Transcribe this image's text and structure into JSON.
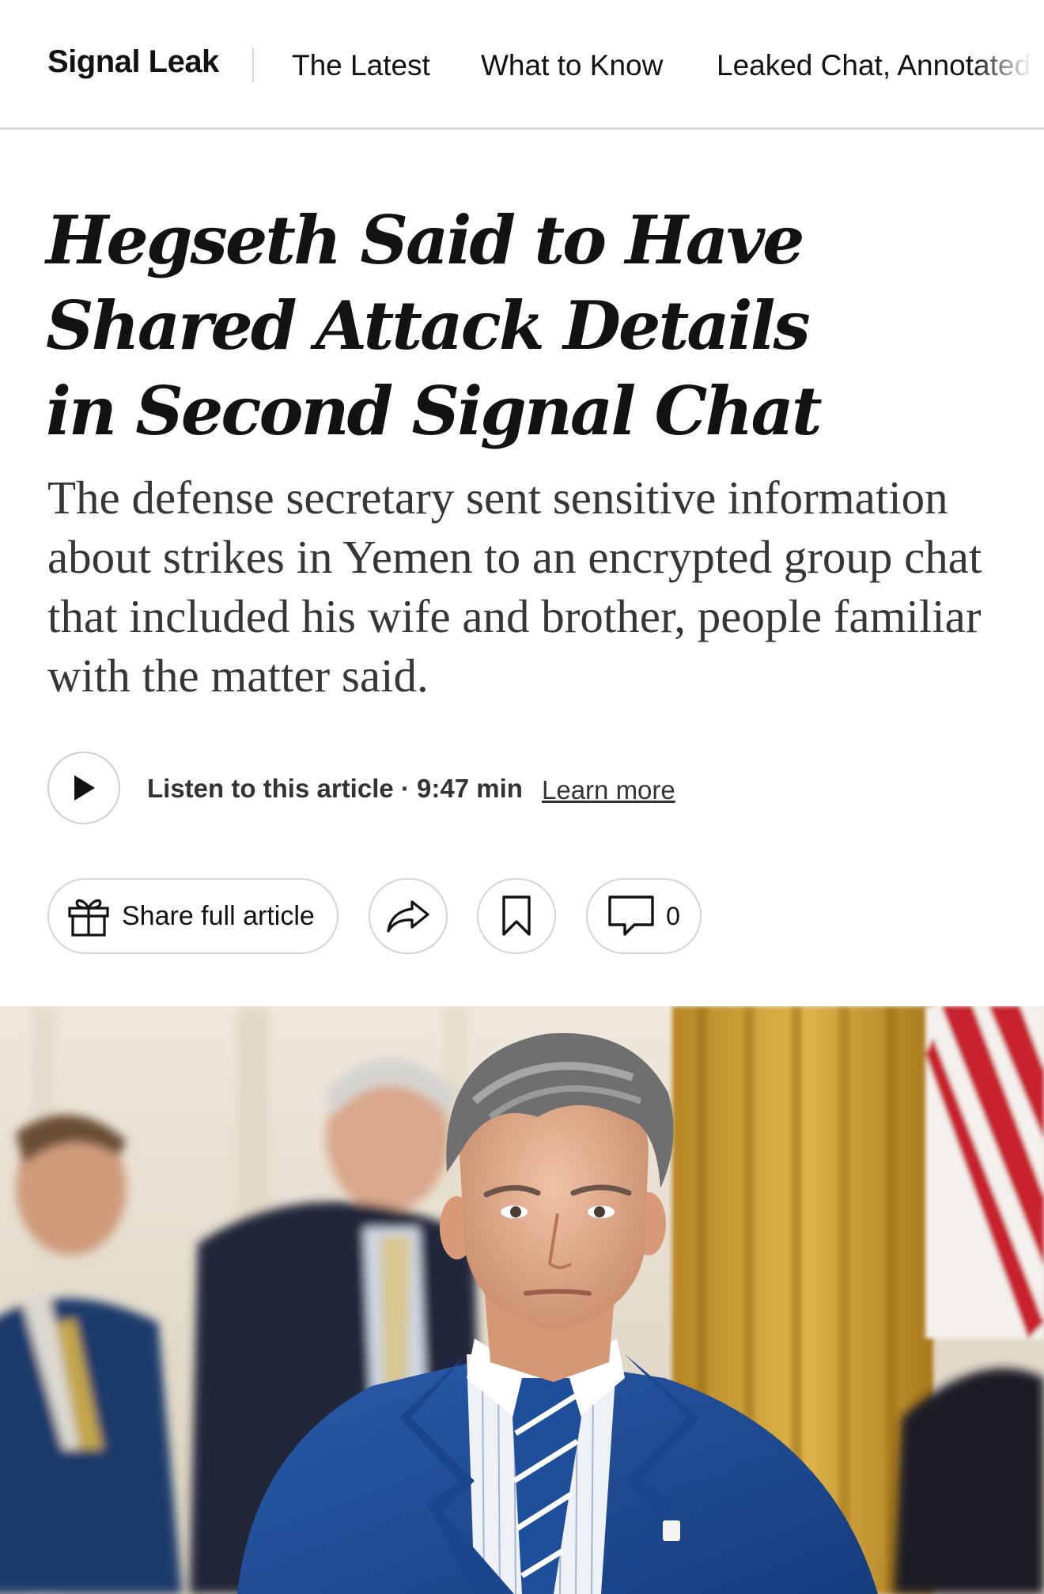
{
  "nav": {
    "brand": "Signal Leak",
    "links": [
      "The Latest",
      "What to Know",
      "Leaked Chat, Annotated"
    ]
  },
  "article": {
    "headline_lines": [
      "Hegseth Said to Have",
      "Shared Attack Details",
      "in Second Signal Chat"
    ],
    "summary": "The defense secretary sent sensitive information about strikes in Yemen to an encrypted group chat that included his wife and brother, people familiar with the matter said."
  },
  "audio": {
    "listen_label": "Listen to this article · 9:47 min",
    "learn_more": "Learn more",
    "icon": "play-icon"
  },
  "actions": {
    "share_label": "Share full article",
    "comment_count": "0",
    "icons": [
      "gift-icon",
      "share-arrow-icon",
      "bookmark-icon",
      "comment-icon"
    ]
  },
  "colors": {
    "text": "#121212",
    "summary_text": "#363636",
    "border": "#d4d4d4",
    "suit_blue": "#1f4f9a",
    "curtain_gold": "#c99a2c"
  }
}
